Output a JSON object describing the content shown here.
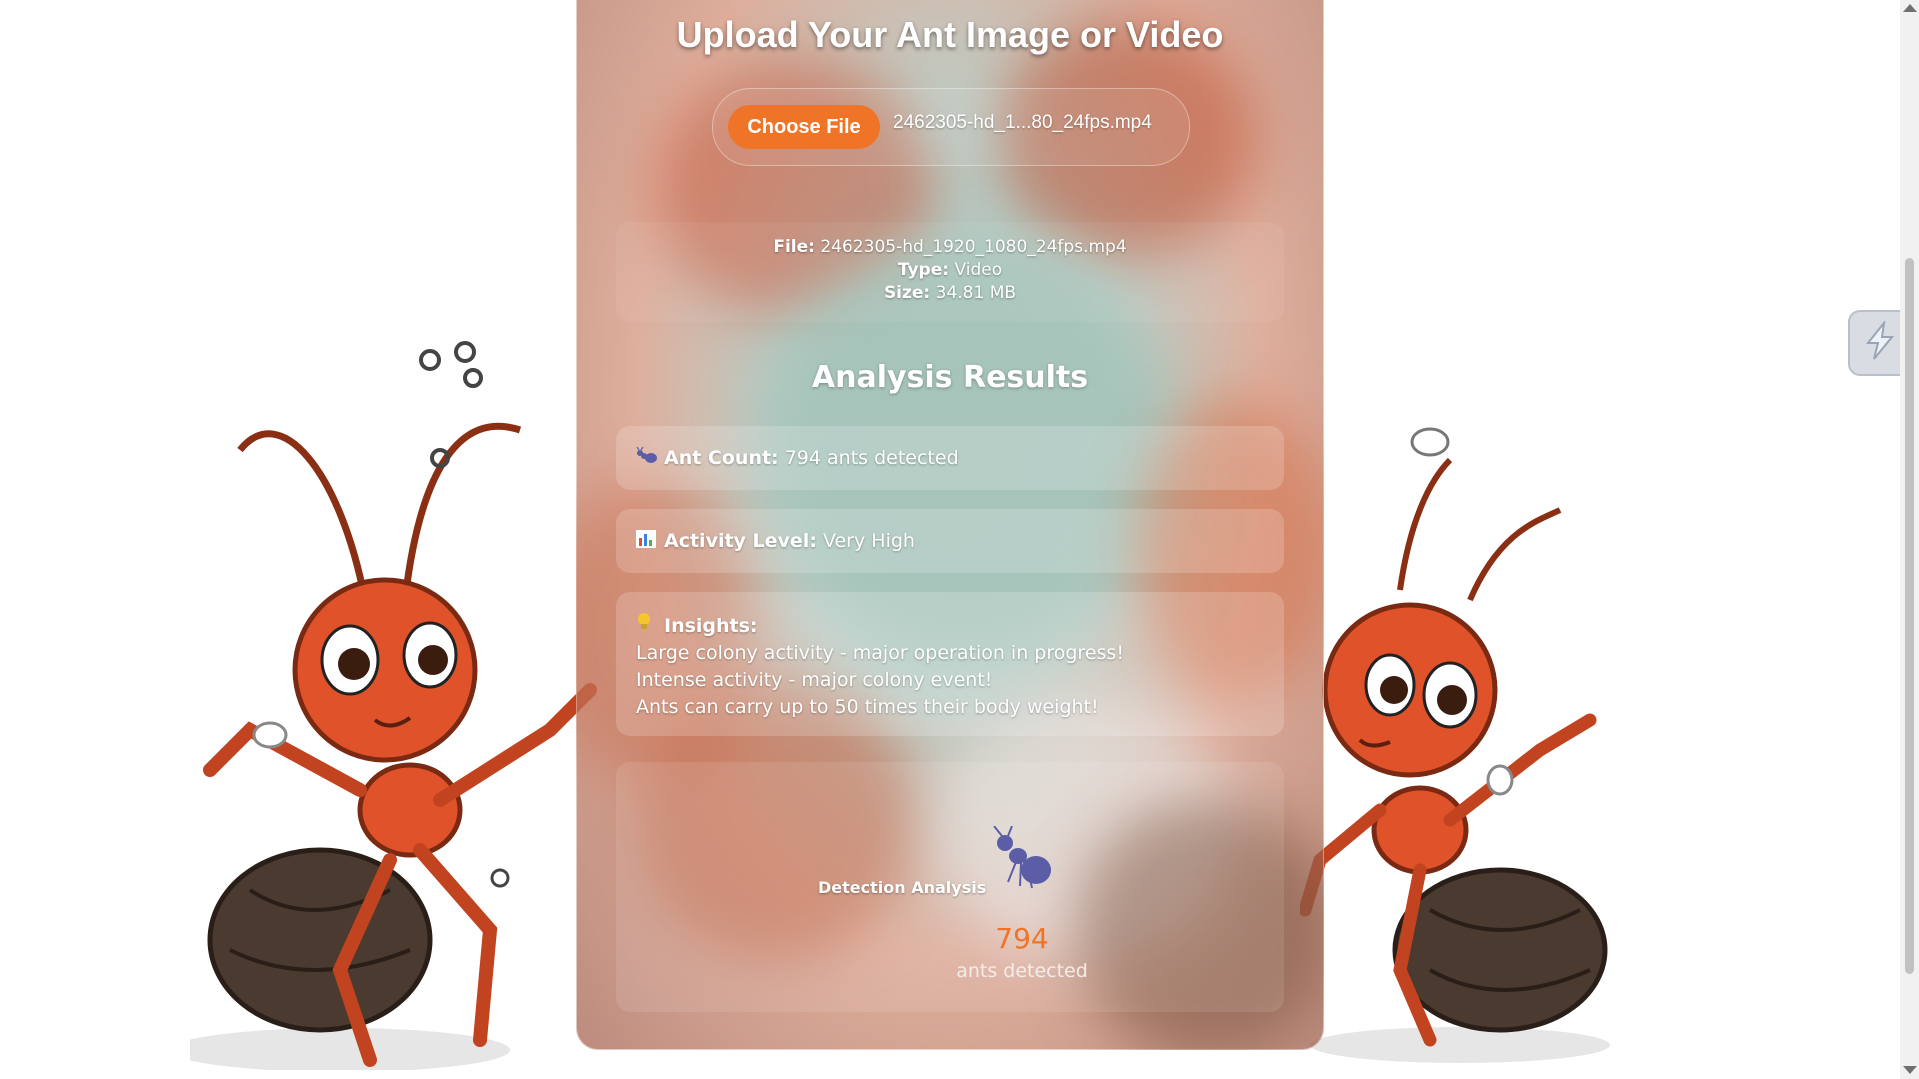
{
  "page": {
    "title": "Upload Your Ant Image or Video"
  },
  "upload": {
    "button_label": "Choose File",
    "selected_file": "2462305-hd_1...80_24fps.mp4"
  },
  "file_info": {
    "file_label": "File:",
    "file_value": "2462305-hd_1920_1080_24fps.mp4",
    "type_label": "Type:",
    "type_value": "Video",
    "size_label": "Size:",
    "size_value": "34.81 MB"
  },
  "results": {
    "title": "Analysis Results",
    "count_label": "Ant Count:",
    "count_value": "794 ants detected",
    "activity_label": "Activity Level:",
    "activity_value": "Very High",
    "insights_label": "Insights:",
    "insights": [
      "Large colony activity - major operation in progress!",
      "Intense activity - major colony event!",
      "Ants can carry up to 50 times their body weight!"
    ]
  },
  "detection": {
    "label": "Detection Analysis",
    "count": "794",
    "sub_label": "ants detected"
  },
  "icons": {
    "count_icon": "ant-icon",
    "activity_icon": "bar-chart-icon",
    "insights_icon": "lightbulb-icon",
    "side_icon": "lightning-icon"
  },
  "colors": {
    "accent": "#f07427",
    "ant_body": "#e0532a"
  }
}
